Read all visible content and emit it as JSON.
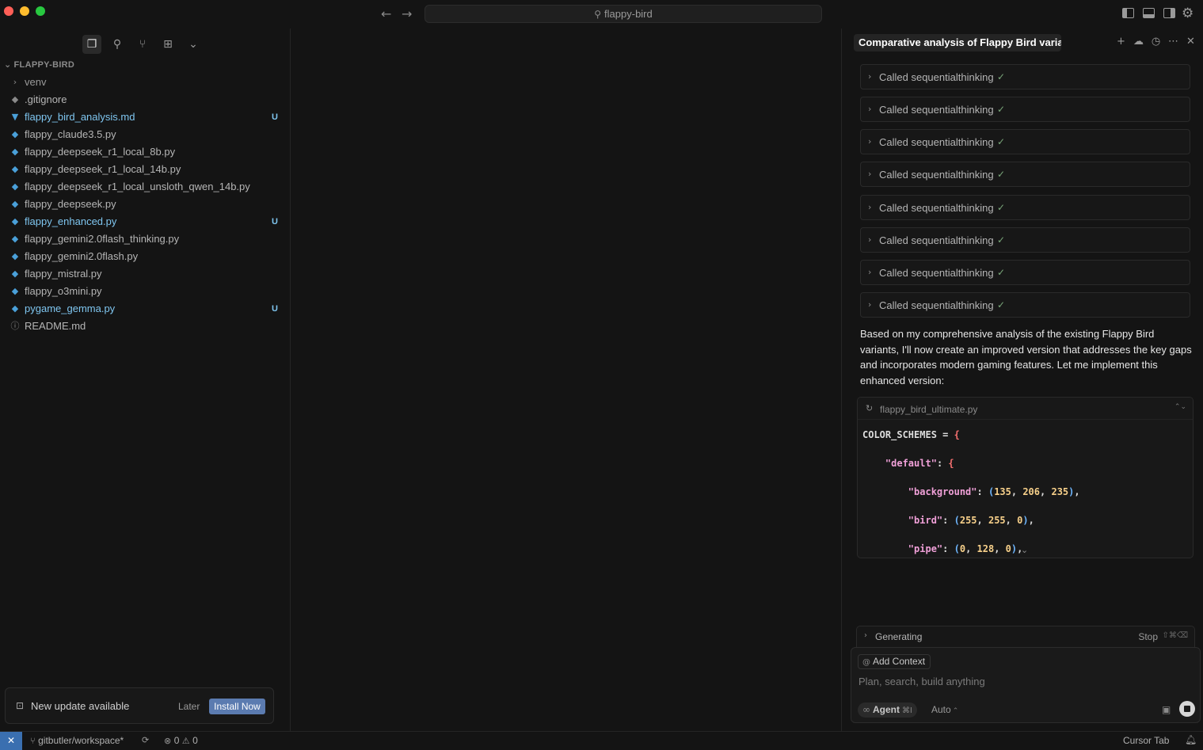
{
  "titlebar": {
    "search_text": "flappy-bird",
    "back_icon": "←",
    "forward_icon": "→"
  },
  "sidebar": {
    "tools": [
      "explorer-icon",
      "search-icon",
      "source-control-icon",
      "extensions-icon",
      "chevron-down-icon"
    ],
    "explorer_title": "FLAPPY-BIRD",
    "files": [
      {
        "name": "venv",
        "type": "folder",
        "badge": ""
      },
      {
        "name": ".gitignore",
        "type": "git",
        "badge": ""
      },
      {
        "name": "flappy_bird_analysis.md",
        "type": "md",
        "badge": "U"
      },
      {
        "name": "flappy_claude3.5.py",
        "type": "py",
        "badge": ""
      },
      {
        "name": "flappy_deepseek_r1_local_8b.py",
        "type": "py",
        "badge": ""
      },
      {
        "name": "flappy_deepseek_r1_local_14b.py",
        "type": "py",
        "badge": ""
      },
      {
        "name": "flappy_deepseek_r1_local_unsloth_qwen_14b.py",
        "type": "py",
        "badge": ""
      },
      {
        "name": "flappy_deepseek.py",
        "type": "py",
        "badge": ""
      },
      {
        "name": "flappy_enhanced.py",
        "type": "py",
        "badge": "U"
      },
      {
        "name": "flappy_gemini2.0flash_thinking.py",
        "type": "py",
        "badge": ""
      },
      {
        "name": "flappy_gemini2.0flash.py",
        "type": "py",
        "badge": ""
      },
      {
        "name": "flappy_mistral.py",
        "type": "py",
        "badge": ""
      },
      {
        "name": "flappy_o3mini.py",
        "type": "py",
        "badge": ""
      },
      {
        "name": "pygame_gemma.py",
        "type": "py",
        "badge": "U"
      },
      {
        "name": "README.md",
        "type": "info",
        "badge": ""
      }
    ],
    "update": {
      "text": "New update available",
      "later": "Later",
      "install": "Install Now"
    }
  },
  "chat": {
    "title": "Comparative analysis of Flappy Bird variants",
    "tool_calls": [
      "Called sequentialthinking",
      "Called sequentialthinking",
      "Called sequentialthinking",
      "Called sequentialthinking",
      "Called sequentialthinking",
      "Called sequentialthinking",
      "Called sequentialthinking",
      "Called sequentialthinking"
    ],
    "message": "Based on my comprehensive analysis of the existing Flappy Bird variants, I'll now create an improved version that addresses the key gaps and incorporates modern gaming features. Let me implement this enhanced version:",
    "code_file": "flappy_bird_ultimate.py",
    "generating_label": "Generating",
    "stop_label": "Stop",
    "stop_shortcut": "⇧⌘⌫",
    "add_context": "Add Context",
    "placeholder": "Plan, search, build anything",
    "agent_label": "Agent",
    "agent_shortcut": "⌘I",
    "model_label": "Auto"
  },
  "statusbar": {
    "branch": "gitbutler/workspace*",
    "errors": "0",
    "warnings": "0",
    "cursor_tab": "Cursor Tab"
  },
  "colors": {
    "accent": "#3a6fb0",
    "install_button": "#5b7bb0",
    "modified_file": "#7fc6f0"
  }
}
